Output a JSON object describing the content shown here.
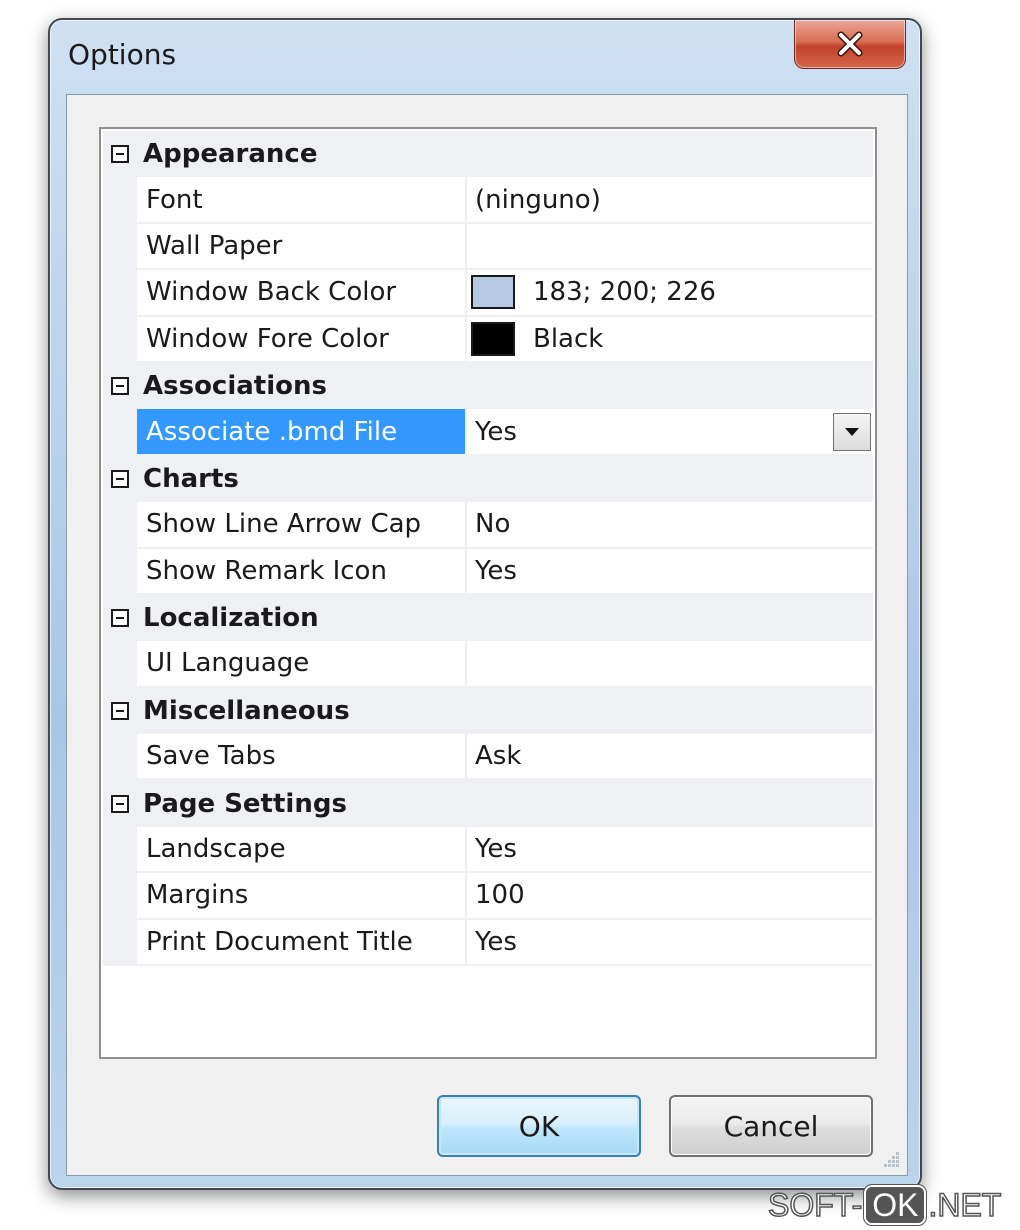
{
  "window": {
    "title": "Options"
  },
  "grid": {
    "categories": [
      {
        "label": "Appearance",
        "properties": [
          {
            "name": "Font",
            "value": "(ninguno)"
          },
          {
            "name": "Wall Paper",
            "value": ""
          },
          {
            "name": "Window Back Color",
            "value": "183; 200; 226",
            "swatch": "#b7c8e2"
          },
          {
            "name": "Window Fore Color",
            "value": "Black",
            "swatch": "#000000"
          }
        ]
      },
      {
        "label": "Associations",
        "properties": [
          {
            "name": "Associate .bmd File",
            "value": "Yes",
            "selected": true,
            "dropdown": true
          }
        ]
      },
      {
        "label": "Charts",
        "properties": [
          {
            "name": "Show Line Arrow Cap",
            "value": "No"
          },
          {
            "name": "Show Remark Icon",
            "value": "Yes"
          }
        ]
      },
      {
        "label": "Localization",
        "properties": [
          {
            "name": "UI Language",
            "value": ""
          }
        ]
      },
      {
        "label": "Miscellaneous",
        "properties": [
          {
            "name": "Save Tabs",
            "value": "Ask"
          }
        ]
      },
      {
        "label": "Page Settings",
        "properties": [
          {
            "name": "Landscape",
            "value": "Yes"
          },
          {
            "name": "Margins",
            "value": "100"
          },
          {
            "name": "Print Document Title",
            "value": "Yes"
          }
        ]
      }
    ]
  },
  "buttons": {
    "ok_label": "OK",
    "cancel_label": "Cancel"
  },
  "watermark": {
    "left": "SOFT-",
    "box": "OK",
    "right": ".NET"
  },
  "colors": {
    "selection": "#3399ff",
    "category_background": "#eef0f4",
    "close_button": "#c2412a"
  },
  "icons": {
    "close": "close-icon",
    "collapse": "collapse-icon",
    "dropdown": "chevron-down-icon",
    "resize": "resize-grip-icon"
  }
}
